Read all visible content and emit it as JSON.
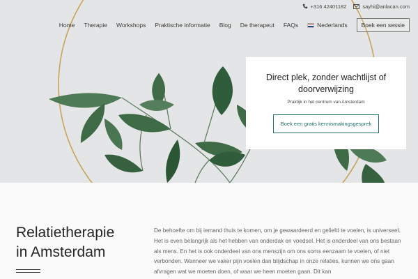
{
  "topbar": {
    "phone_icon": "phone-icon",
    "phone": "+316 42401182",
    "email_icon": "envelope-icon",
    "email": "sayhi@anlacan.com"
  },
  "nav": {
    "items": [
      "Home",
      "Therapie",
      "Workshops",
      "Praktische informatie",
      "Blog",
      "De therapeut",
      "FAQs"
    ],
    "language": "Nederlands",
    "language_icon": "flag-nl-icon",
    "cta": "Boek een sessie"
  },
  "hero": {
    "card_title": "Direct plek, zonder wachtlijst of doorverwijzing",
    "card_subtitle": "Praktijk in het centrum van Amsterdam",
    "card_button": "Boek een gratis kennismakingsgesprek",
    "accent_color": "#1f6f6a"
  },
  "intro": {
    "heading_line1": "Relatietherapie",
    "heading_line2": "in Amsterdam",
    "paragraph": "De behoefte om bij iemand thuis te komen, om je gewaardeerd en geliefd te voelen, is universeel. Het is even belangrijk als het hebben van onderdak en voedsel. Het is onderdeel van ons bestaan als mens. En het is ook onderdeel van ons menszijn om ons soms eenzaam te voelen, of niet verbonden. Wanneer we vaker pijn voelen dan blijdschap in onze relaties, kunnen we ons gaan afvragen wat we moeten doen, of waar we heen moeten gaan. Dit kan"
  }
}
